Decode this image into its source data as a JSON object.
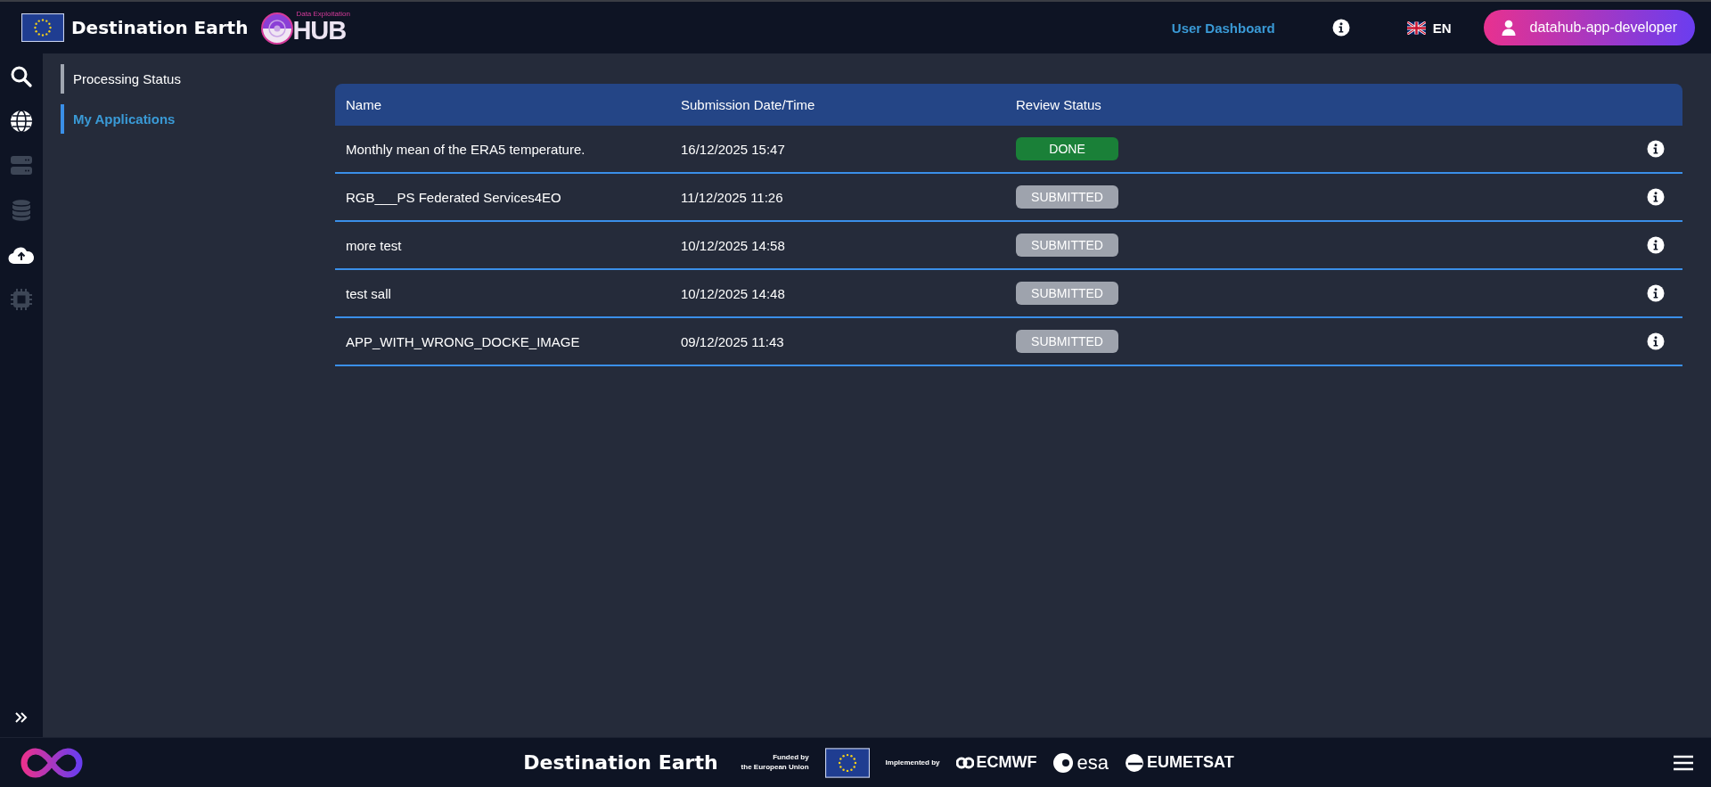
{
  "header": {
    "brand": "Destination Earth",
    "hub_caption": "Data Exploitation",
    "hub_name": "HUB",
    "dashboard_link": "User Dashboard",
    "language": "EN",
    "user": "datahub-app-developer"
  },
  "rail": [
    {
      "kind": "search",
      "disabled": false
    },
    {
      "kind": "globe",
      "disabled": false
    },
    {
      "kind": "servers",
      "disabled": true
    },
    {
      "kind": "database",
      "disabled": true
    },
    {
      "kind": "upload",
      "disabled": false
    },
    {
      "kind": "chip",
      "disabled": true
    }
  ],
  "subnav": [
    {
      "label": "Processing Status",
      "selected": false
    },
    {
      "label": "My Applications",
      "selected": true
    }
  ],
  "table": {
    "columns": [
      "Name",
      "Submission Date/Time",
      "Review Status"
    ],
    "rows": [
      {
        "name": "Monthly mean of the ERA5 temperature.",
        "date": "16/12/2025 15:47",
        "status": "DONE",
        "kind": "done"
      },
      {
        "name": "RGB___PS Federated Services4EO",
        "date": "11/12/2025 11:26",
        "status": "SUBMITTED",
        "kind": "submitted"
      },
      {
        "name": "more test",
        "date": "10/12/2025 14:58",
        "status": "SUBMITTED",
        "kind": "submitted"
      },
      {
        "name": "test sall",
        "date": "10/12/2025 14:48",
        "status": "SUBMITTED",
        "kind": "submitted"
      },
      {
        "name": "APP_WITH_WRONG_DOCKE_IMAGE",
        "date": "09/12/2025 11:43",
        "status": "SUBMITTED",
        "kind": "submitted"
      }
    ]
  },
  "footer": {
    "brand": "Destination Earth",
    "funded_line1": "Funded by",
    "funded_line2": "the European Union",
    "implemented": "Implemented by",
    "partners": [
      "ECMWF",
      "esa",
      "EUMETSAT"
    ]
  }
}
